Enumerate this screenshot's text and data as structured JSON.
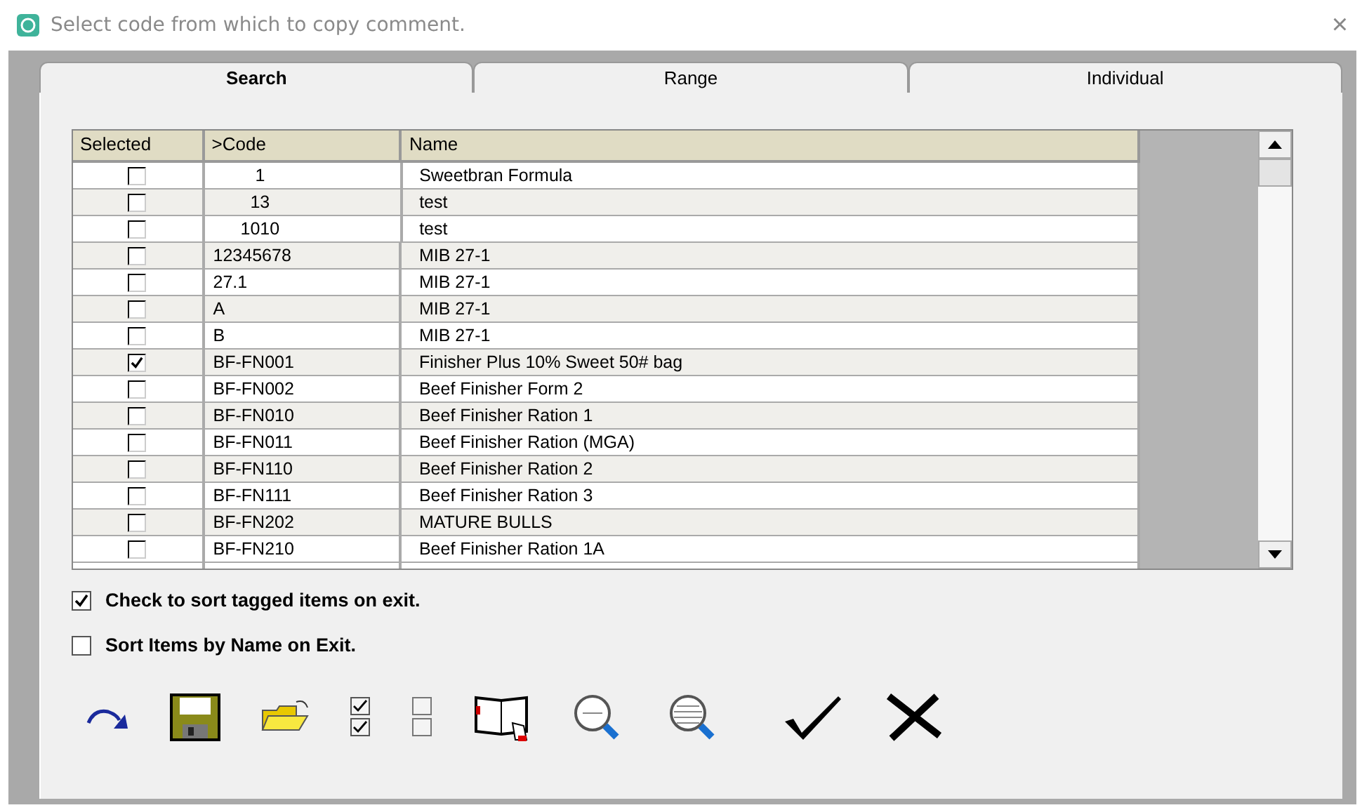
{
  "window": {
    "title": "Select code from which to copy comment.",
    "close": "×"
  },
  "tabs": [
    {
      "label": "Search",
      "selected": true
    },
    {
      "label": "Range",
      "selected": false
    },
    {
      "label": "Individual",
      "selected": false
    }
  ],
  "table": {
    "columns": [
      "Selected",
      ">Code",
      "Name"
    ],
    "rows": [
      {
        "checked": false,
        "code": "1",
        "kind": "centered",
        "name": "Sweetbran Formula"
      },
      {
        "checked": false,
        "code": "13",
        "kind": "centered",
        "name": "test"
      },
      {
        "checked": false,
        "code": "1010",
        "kind": "centered",
        "name": "test"
      },
      {
        "checked": false,
        "code": "12345678",
        "kind": "left",
        "name": "MIB 27-1"
      },
      {
        "checked": false,
        "code": "27.1",
        "kind": "left",
        "name": "MIB 27-1"
      },
      {
        "checked": false,
        "code": "A",
        "kind": "left",
        "name": "MIB 27-1"
      },
      {
        "checked": false,
        "code": "B",
        "kind": "left",
        "name": "MIB 27-1"
      },
      {
        "checked": true,
        "code": "BF-FN001",
        "kind": "left",
        "name": "Finisher Plus 10% Sweet 50# bag"
      },
      {
        "checked": false,
        "code": "BF-FN002",
        "kind": "left",
        "name": "Beef Finisher Form 2"
      },
      {
        "checked": false,
        "code": "BF-FN010",
        "kind": "left",
        "name": "Beef Finisher Ration 1"
      },
      {
        "checked": false,
        "code": "BF-FN011",
        "kind": "left",
        "name": "Beef Finisher Ration (MGA)"
      },
      {
        "checked": false,
        "code": "BF-FN110",
        "kind": "left",
        "name": "Beef Finisher Ration 2"
      },
      {
        "checked": false,
        "code": "BF-FN111",
        "kind": "left",
        "name": "Beef Finisher Ration 3"
      },
      {
        "checked": false,
        "code": "BF-FN202",
        "kind": "left",
        "name": "MATURE BULLS"
      },
      {
        "checked": false,
        "code": "BF-FN210",
        "kind": "left",
        "name": "Beef Finisher Ration 1A"
      }
    ]
  },
  "options": [
    {
      "label": "Check to sort tagged items on exit.",
      "checked": true
    },
    {
      "label": "Sort Items by Name on Exit.",
      "checked": false
    }
  ],
  "toolbar": [
    {
      "kind": "redo"
    },
    {
      "kind": "save"
    },
    {
      "kind": "open"
    },
    {
      "kind": "check-all"
    },
    {
      "kind": "uncheck-all"
    },
    {
      "kind": "book"
    },
    {
      "kind": "zoom"
    },
    {
      "kind": "find"
    },
    {
      "kind": "ok"
    },
    {
      "kind": "cancel"
    }
  ]
}
